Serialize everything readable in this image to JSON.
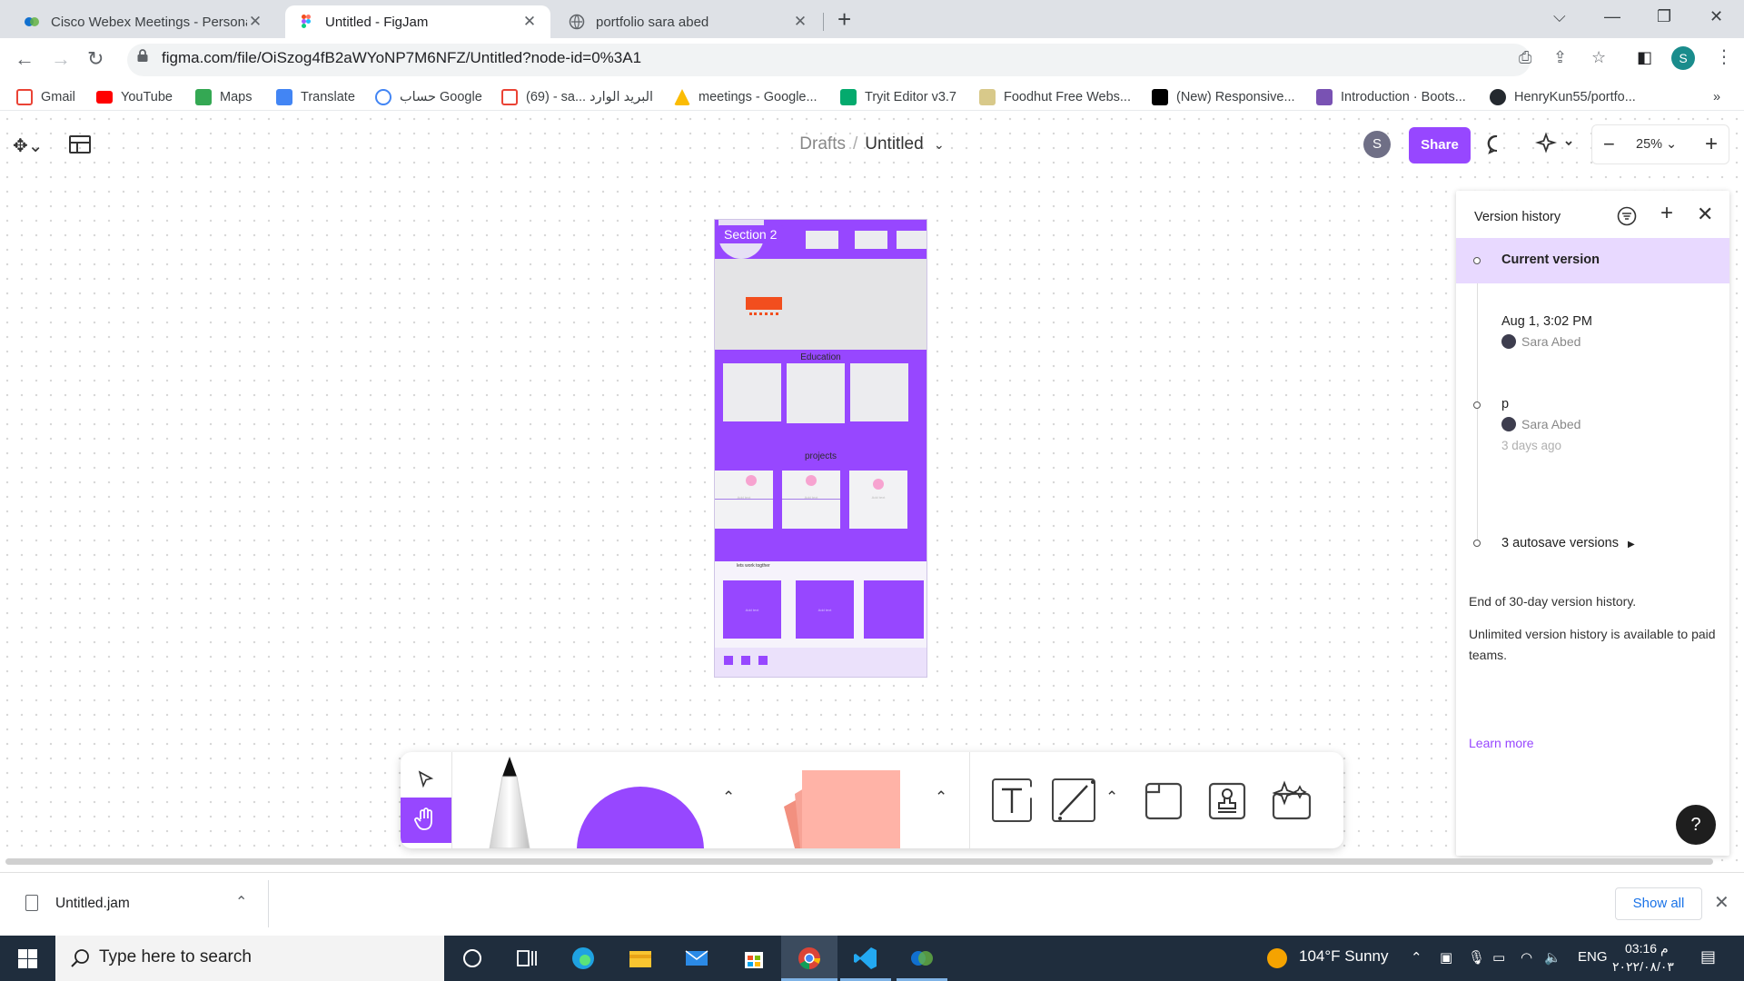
{
  "browser": {
    "tabs": [
      {
        "title": "Cisco Webex Meetings - Persona",
        "active": false
      },
      {
        "title": "Untitled - FigJam",
        "active": true
      },
      {
        "title": "portfolio sara abed",
        "active": false
      }
    ],
    "url": "figma.com/file/OiSzog4fB2aWYoNP7M6NFZ/Untitled?node-id=0%3A1",
    "profile_initial": "S",
    "bookmarks": [
      "Gmail",
      "YouTube",
      "Maps",
      "Translate",
      "حساب Google",
      "(69) - sa... البريد الوارد",
      "meetings - Google...",
      "Tryit Editor v3.7",
      "Foodhut Free Webs...",
      "(New) Responsive...",
      "Introduction · Boots...",
      "HenryKun55/portfo..."
    ],
    "bookmarks_more": "»"
  },
  "figjam": {
    "breadcrumb": {
      "parent": "Drafts",
      "separator": "/",
      "current": "Untitled"
    },
    "user_initial": "S",
    "share_label": "Share",
    "zoom": "25%",
    "mockup": {
      "section_label": "Section 2",
      "education_label": "Education",
      "projects_label": "projects",
      "footer_label": "lets work togther",
      "card_text": "Add text"
    }
  },
  "version_history": {
    "title": "Version history",
    "current": "Current version",
    "entries": [
      {
        "label": "Aug 1, 3:02 PM",
        "author": "Sara Abed",
        "meta": ""
      },
      {
        "label": "p",
        "author": "Sara Abed",
        "meta": "3 days ago"
      }
    ],
    "autosave": "3 autosave versions",
    "end_note": "End of 30-day version history.",
    "unlimited_note": "Unlimited version history is available to paid teams.",
    "learn_more": "Learn more"
  },
  "downloads": {
    "file": "Untitled.jam",
    "show_all": "Show all"
  },
  "taskbar": {
    "search_placeholder": "Type here to search",
    "weather": "104°F  Sunny",
    "lang": "ENG",
    "time": "03:16 م",
    "date": "٢٠٢٢/٠٨/٠٣"
  },
  "colors": {
    "brand_purple": "#9747ff",
    "version_highlight": "#e8d9ff",
    "sticky_salmon": "#ffb3a7",
    "taskbar": "#1f2d3d"
  }
}
